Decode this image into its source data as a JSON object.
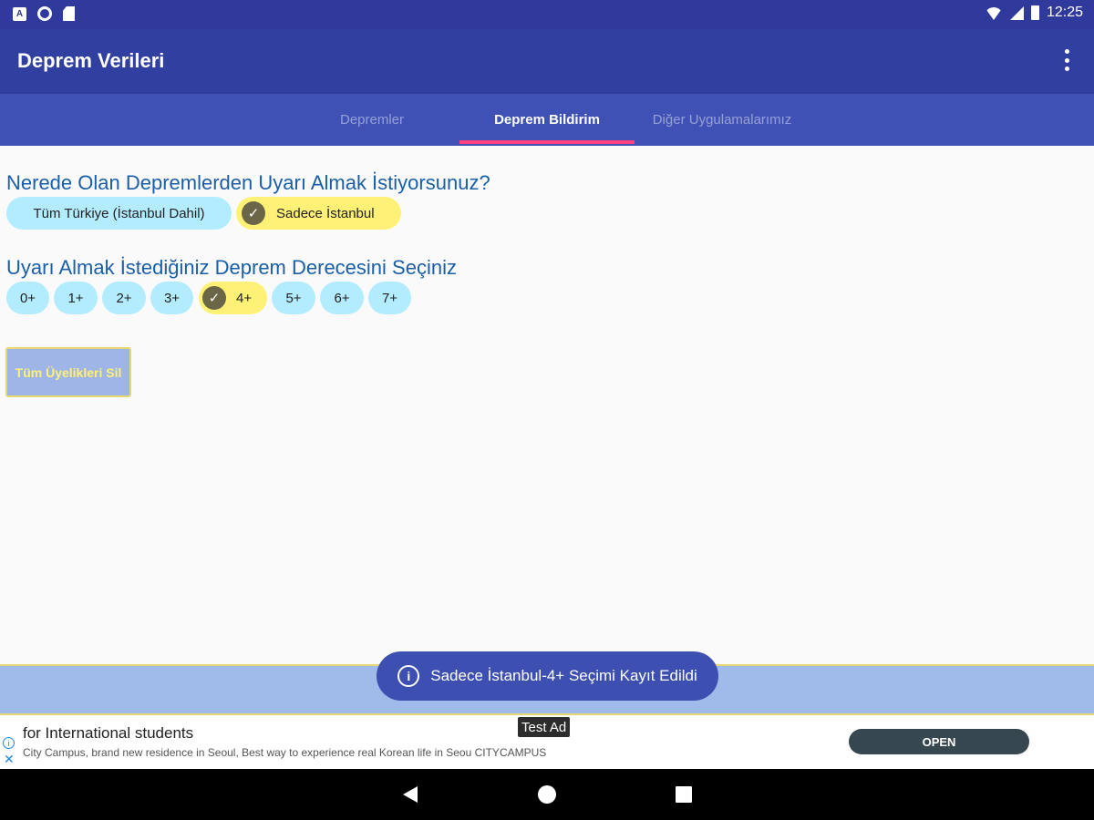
{
  "status_bar": {
    "time": "12:25"
  },
  "app_bar": {
    "title": "Deprem Verileri"
  },
  "tabs": [
    {
      "label": "Depremler",
      "active": false
    },
    {
      "label": "Deprem Bildirim",
      "active": true
    },
    {
      "label": "Diğer Uygulamalarımız",
      "active": false
    }
  ],
  "location_section": {
    "title": "Nerede Olan Depremlerden Uyarı Almak İstiyorsunuz?",
    "options": [
      {
        "label": "Tüm Türkiye (İstanbul Dahil)",
        "selected": false
      },
      {
        "label": "Sadece İstanbul",
        "selected": true
      }
    ]
  },
  "magnitude_section": {
    "title": "Uyarı Almak İstediğiniz Deprem Derecesini Seçiniz",
    "options": [
      {
        "label": "0+",
        "selected": false
      },
      {
        "label": "1+",
        "selected": false
      },
      {
        "label": "2+",
        "selected": false
      },
      {
        "label": "3+",
        "selected": false
      },
      {
        "label": "4+",
        "selected": true
      },
      {
        "label": "5+",
        "selected": false
      },
      {
        "label": "6+",
        "selected": false
      },
      {
        "label": "7+",
        "selected": false
      }
    ]
  },
  "delete_button": {
    "label": "Tüm Üyelikleri Sil"
  },
  "toast": {
    "message": "Sadece İstanbul-4+ Seçimi Kayıt Edildi"
  },
  "ad": {
    "badge": "Test Ad",
    "headline": "for International students",
    "body": "City Campus, brand new residence in Seoul, Best way to experience real Korean life in Seou CITYCAMPUS",
    "cta": "OPEN"
  },
  "colors": {
    "primary": "#3f51b5",
    "primary_dark": "#2f3a9c",
    "accent": "#ff4081",
    "chip": "#b3ecff",
    "chip_selected": "#fff176",
    "question_text": "#1a5fa8"
  }
}
